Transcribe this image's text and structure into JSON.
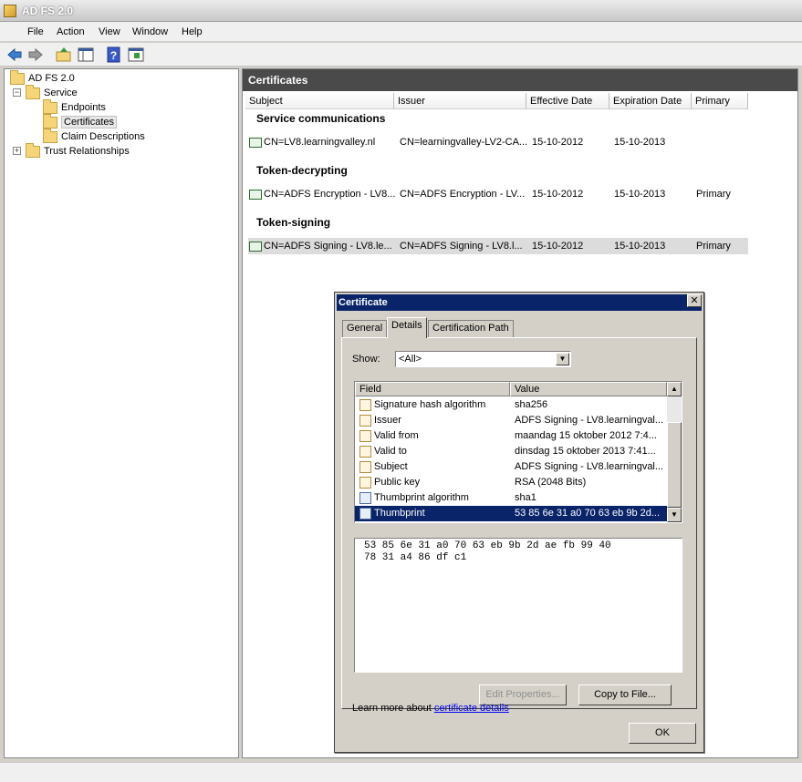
{
  "window": {
    "title": "AD FS 2.0"
  },
  "menu": [
    "File",
    "Action",
    "View",
    "Window",
    "Help"
  ],
  "tree": {
    "root": "AD FS 2.0",
    "service": "Service",
    "endpoints": "Endpoints",
    "certificates": "Certificates",
    "claims": "Claim Descriptions",
    "trust": "Trust Relationships"
  },
  "pane": {
    "title": "Certificates",
    "columns": [
      "Subject",
      "Issuer",
      "Effective Date",
      "Expiration Date",
      "Primary"
    ],
    "groups": [
      {
        "label": "Service communications",
        "rows": [
          {
            "subject": "CN=LV8.learningvalley.nl",
            "issuer": "CN=learningvalley-LV2-CA...",
            "effective": "15-10-2012",
            "expiration": "15-10-2013",
            "primary": ""
          }
        ]
      },
      {
        "label": "Token-decrypting",
        "rows": [
          {
            "subject": "CN=ADFS Encryption - LV8...",
            "issuer": "CN=ADFS Encryption - LV...",
            "effective": "15-10-2012",
            "expiration": "15-10-2013",
            "primary": "Primary"
          }
        ]
      },
      {
        "label": "Token-signing",
        "rows": [
          {
            "subject": "CN=ADFS Signing - LV8.le...",
            "issuer": "CN=ADFS Signing - LV8.l...",
            "effective": "15-10-2012",
            "expiration": "15-10-2013",
            "primary": "Primary"
          }
        ]
      }
    ]
  },
  "dialog": {
    "title": "Certificate",
    "close": "✕",
    "tabs": [
      "General",
      "Details",
      "Certification Path"
    ],
    "show_label": "Show:",
    "show_value": "<All>",
    "list_headers": [
      "Field",
      "Value"
    ],
    "fields": [
      {
        "field": "Signature hash algorithm",
        "value": "sha256"
      },
      {
        "field": "Issuer",
        "value": "ADFS Signing - LV8.learningval..."
      },
      {
        "field": "Valid from",
        "value": "maandag 15 oktober 2012 7:4..."
      },
      {
        "field": "Valid to",
        "value": "dinsdag 15 oktober 2013 7:41..."
      },
      {
        "field": "Subject",
        "value": "ADFS Signing - LV8.learningval..."
      },
      {
        "field": "Public key",
        "value": "RSA (2048 Bits)"
      },
      {
        "field": "Thumbprint algorithm",
        "value": "sha1"
      },
      {
        "field": "Thumbprint",
        "value": "53 85 6e 31 a0 70 63 eb 9b 2d..."
      }
    ],
    "value_text": "53 85 6e 31 a0 70 63 eb 9b 2d ae fb 99 40\n78 31 a4 86 df c1",
    "edit_button": "Edit Properties...",
    "copy_button": "Copy to File...",
    "learn_text": "Learn more about ",
    "learn_link": "certificate details",
    "ok_button": "OK"
  }
}
